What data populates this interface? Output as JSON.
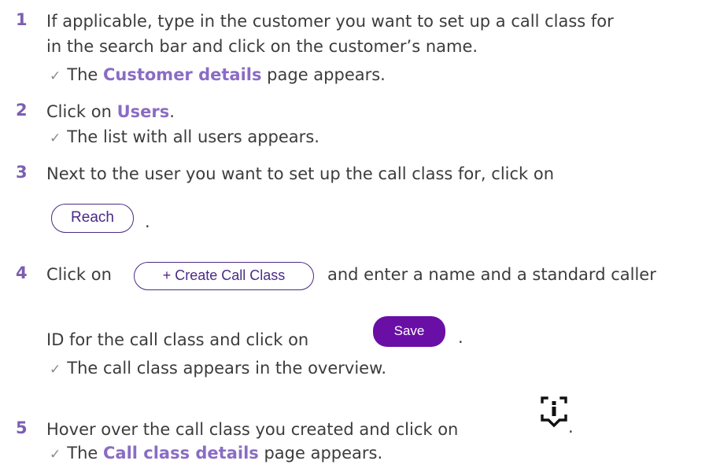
{
  "colors": {
    "step_number": "#7b5fb1",
    "highlight": "#8a6cc4",
    "body_text": "#3c3c3c",
    "outline_button": "#4b2a86",
    "save_button": "#6a0fa5"
  },
  "steps": [
    {
      "number": "1",
      "line1": "If applicable, type in the customer you want to set up a call class for",
      "line2": "in the search bar and click on the customer’s name.",
      "result_prefix": "The ",
      "result_link": "Customer details",
      "result_suffix": " page appears."
    },
    {
      "number": "2",
      "text_prefix": "Click on ",
      "text_link": "Users",
      "text_suffix": ".",
      "result": "The list with all users appears."
    },
    {
      "number": "3",
      "text": "Next to the user you want to set up the call class for, click on",
      "button_label": "Reach",
      "button_icon": "reach-button",
      "trailing": "."
    },
    {
      "number": "4",
      "text_prefix": "Click on",
      "create_button_label": "+ Create Call Class",
      "text_middle": "and enter a name and a standard caller",
      "line2": "ID for the call class and click on",
      "save_button_label": "Save",
      "trailing": ".",
      "result": "The call class appears in the overview."
    },
    {
      "number": "5",
      "text": "Hover over the call class you created and click on",
      "icon": "info-icon",
      "trailing": ".",
      "result_prefix": "The ",
      "result_link": "Call class details",
      "result_suffix": " page appears."
    }
  ]
}
